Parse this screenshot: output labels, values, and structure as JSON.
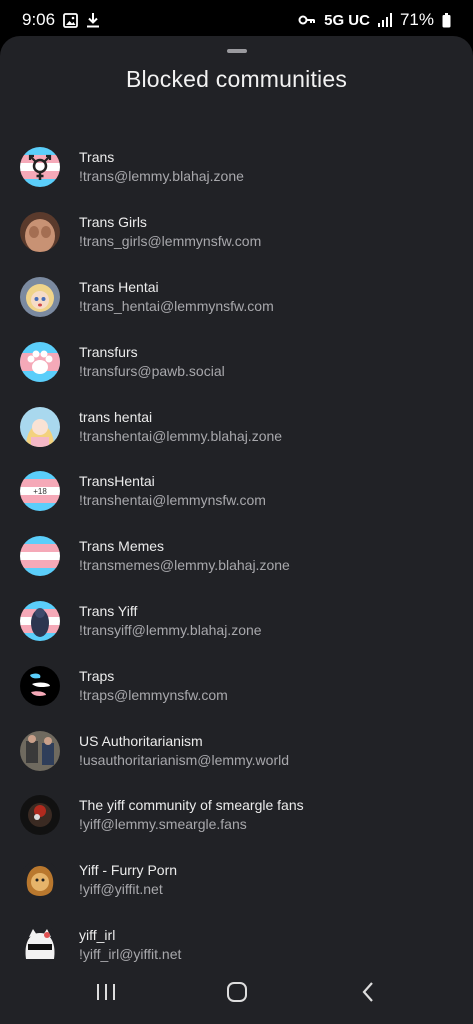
{
  "status": {
    "time": "9:06",
    "network": "5G UC",
    "battery": "71%",
    "left_icons": [
      "gallery-icon",
      "download-icon"
    ],
    "right_icons": [
      "vpn-key-icon",
      "signal-icon",
      "battery-icon"
    ]
  },
  "sheet": {
    "title": "Blocked communities"
  },
  "communities": [
    {
      "name": "Trans",
      "address": "!trans@lemmy.blahaj.zone"
    },
    {
      "name": "Trans Girls",
      "address": "!trans_girls@lemmynsfw.com"
    },
    {
      "name": "Trans Hentai",
      "address": "!trans_hentai@lemmynsfw.com"
    },
    {
      "name": "Transfurs",
      "address": "!transfurs@pawb.social"
    },
    {
      "name": "trans hentai",
      "address": "!transhentai@lemmy.blahaj.zone"
    },
    {
      "name": "TransHentai",
      "address": "!transhentai@lemmynsfw.com",
      "badge": "+18"
    },
    {
      "name": "Trans Memes",
      "address": "!transmemes@lemmy.blahaj.zone"
    },
    {
      "name": "Trans Yiff",
      "address": "!transyiff@lemmy.blahaj.zone"
    },
    {
      "name": "Traps",
      "address": "!traps@lemmynsfw.com"
    },
    {
      "name": "US Authoritarianism",
      "address": "!usauthoritarianism@lemmy.world"
    },
    {
      "name": "The yiff community of smeargle fans",
      "address": "!yiff@lemmy.smeargle.fans"
    },
    {
      "name": "Yiff - Furry Porn",
      "address": "!yiff@yiffit.net"
    },
    {
      "name": "yiff_irl",
      "address": "!yiff_irl@yiffit.net"
    }
  ],
  "nav": {
    "buttons": [
      "recent-apps",
      "home",
      "back"
    ]
  },
  "colors": {
    "sheet_bg": "#212226",
    "trans_blue": "#5BCEFA",
    "trans_pink": "#F5A9B8",
    "white": "#FFFFFF"
  }
}
